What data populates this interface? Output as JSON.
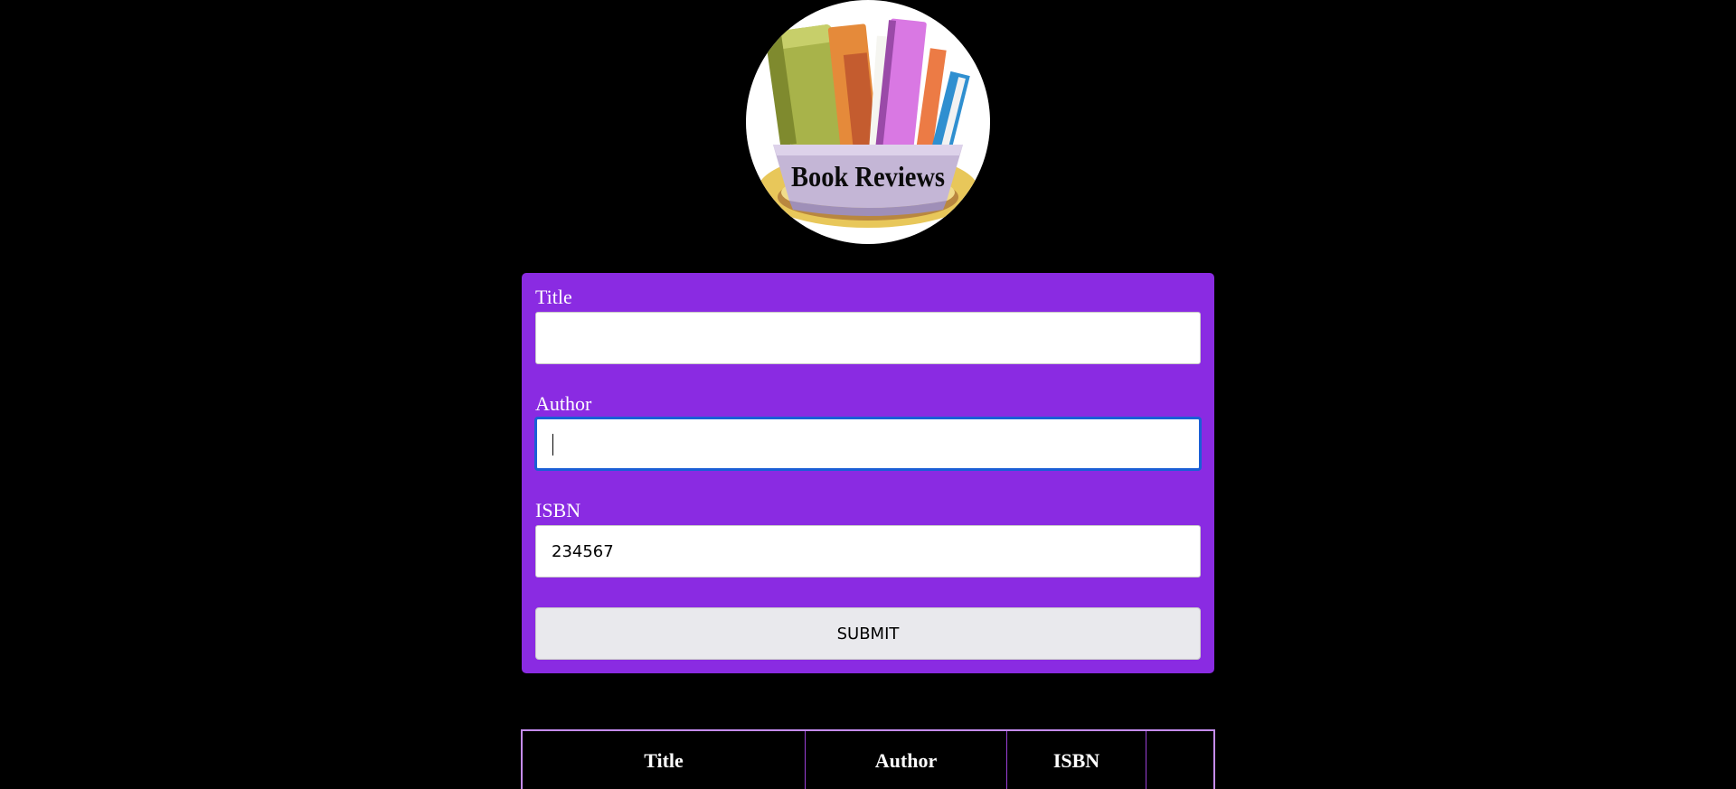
{
  "logo": {
    "text": "Book Reviews",
    "icon": "book-basket-logo"
  },
  "form": {
    "fields": [
      {
        "label": "Title",
        "value": "",
        "placeholder": ""
      },
      {
        "label": "Author",
        "value": "",
        "placeholder": ""
      },
      {
        "label": "ISBN",
        "value": "234567",
        "placeholder": ""
      }
    ],
    "submit_label": "SUBMIT"
  },
  "table": {
    "headers": [
      "Title",
      "Author",
      "ISBN",
      ""
    ]
  },
  "colors": {
    "background": "#000000",
    "panel": "#8a2be2",
    "focus_ring": "#1a5fd6",
    "table_border": "#c58cf0"
  }
}
